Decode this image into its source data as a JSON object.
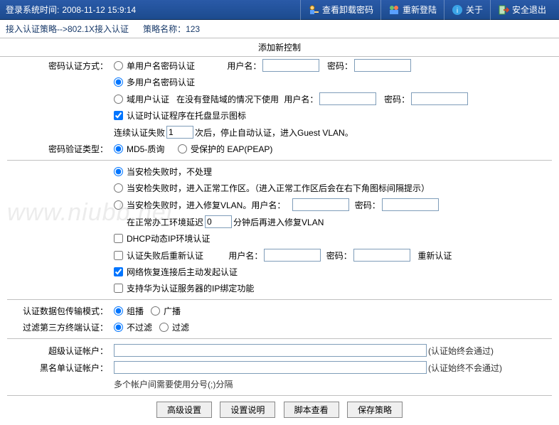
{
  "topbar": {
    "login_time_label": "登录系统时间:",
    "login_time_value": "2008-11-12 15:9:14",
    "nav": {
      "view_pwd": "查看卸载密码",
      "relogin": "重新登陆",
      "about": "关于",
      "exit": "安全退出"
    }
  },
  "breadcrumb": {
    "path": "接入认证策略-->802.1X接入认证",
    "policy_name_label": "策略名称：",
    "policy_name_value": "123"
  },
  "section_title": "添加新控制",
  "pwd_auth": {
    "label": "密码认证方式：",
    "opt_single": "单用户名密码认证",
    "user_label": "用户名：",
    "pwd_label": "密码：",
    "opt_multi": "多用户名密码认证",
    "opt_domain": "域用户认证",
    "domain_note": "在没有登陆域的情况下使用",
    "checkbox_tray": "认证时认证程序在托盘显示图标",
    "fail_pre": "连续认证失败",
    "fail_value": "1",
    "fail_post": "次后，停止自动认证，进入Guest VLAN。"
  },
  "pwd_verify": {
    "label": "密码验证类型：",
    "opt_md5": "MD5-质询",
    "opt_peap": "受保护的 EAP(PEAP)"
  },
  "sec_check": {
    "opt_none": "当安检失败时，不处理",
    "opt_normal": "当安检失败时，进入正常工作区。（进入正常工作区后会在右下角图标间隔提示）",
    "opt_fix": "当安检失败时，进入修复VLAN。用户名：",
    "pwd_label": "密码：",
    "delay_pre": "在正常办工环境延迟",
    "delay_value": "0",
    "delay_post": "分钟后再进入修复VLAN",
    "chk_dhcp": "DHCP动态IP环境认证",
    "chk_reauth": "认证失败后重新认证",
    "reauth_user_label": "用户名：",
    "reauth_pwd_label": "密码：",
    "reauth_btn": "重新认证",
    "chk_network": "网络恢复连接后主动发起认证",
    "chk_huawei": "支持华为认证服务器的IP绑定功能"
  },
  "transport": {
    "label": "认证数据包传输模式：",
    "opt_multicast": "组播",
    "opt_broadcast": "广播"
  },
  "filter": {
    "label": "过滤第三方终端认证：",
    "opt_no": "不过滤",
    "opt_yes": "过滤"
  },
  "super_acct": {
    "label": "超级认证帐户：",
    "note": "(认证始终会通过)"
  },
  "black_acct": {
    "label": "黑名单认证帐户：",
    "note": "(认证始终不会通过)",
    "hint": "多个帐户间需要使用分号(;)分隔"
  },
  "buttons": {
    "advanced": "高级设置",
    "desc": "设置说明",
    "script": "脚本查看",
    "save": "保存策略"
  },
  "watermark": "www.niubb.net"
}
